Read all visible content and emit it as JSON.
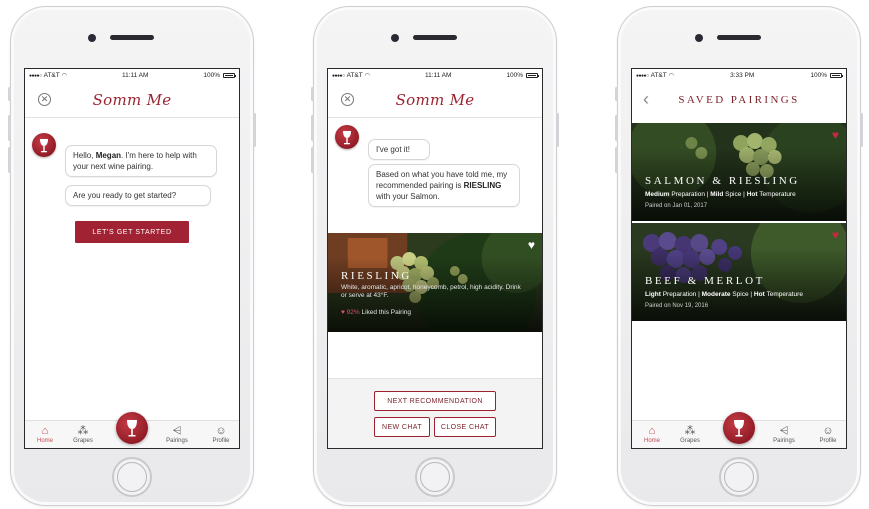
{
  "status_bar": {
    "screen1": {
      "carrier": "AT&T",
      "time": "11:11 AM",
      "battery": "100%"
    },
    "screen2": {
      "carrier": "AT&T",
      "time": "11:11 AM",
      "battery": "100%"
    },
    "screen3": {
      "carrier": "AT&T",
      "time": "3:33 PM",
      "battery": "100%"
    }
  },
  "app": {
    "logo_text": "Somm Me"
  },
  "screen1": {
    "greeting_hello": "Hello, ",
    "greeting_name": "Megan",
    "greeting_rest": ". I'm here to help with your next wine pairing.",
    "question": "Are you ready to get started?",
    "start_button": "LET'S GET STARTED"
  },
  "screen2": {
    "bubble_got_it": "I've got it!",
    "recommend_before": "Based on what you have told me, my recommended pairing is ",
    "recommend_wine": "RIESLING",
    "recommend_after": " with your Salmon.",
    "card": {
      "name": "RIESLING",
      "description": "White, aromatic, apricot, honeycomb, petrol, high acidity. Drink or serve at 43°F.",
      "like_percent": "92%",
      "like_text": " Liked this Pairing"
    },
    "next_button": "NEXT RECOMMENDATION",
    "new_chat_button": "NEW CHAT",
    "close_chat_button": "CLOSE CHAT"
  },
  "screen3": {
    "title": "SAVED PAIRINGS",
    "pairings": [
      {
        "name": "SALMON & RIESLING",
        "prep_value": "Medium",
        "prep_label": " Preparation",
        "spice_value": "Mild",
        "spice_label": " Spice",
        "temp_value": "Hot",
        "temp_label": " Temperature",
        "date": "Paired on Jan 01, 2017"
      },
      {
        "name": "BEEF & MERLOT",
        "prep_value": "Light",
        "prep_label": " Preparation",
        "spice_value": "Moderate",
        "spice_label": " Spice",
        "temp_value": "Hot",
        "temp_label": " Temperature",
        "date": "Paired on Nov 19, 2016"
      }
    ],
    "separator": " | "
  },
  "tab_bar": {
    "items": [
      {
        "label": "Home",
        "icon": "home-icon"
      },
      {
        "label": "Grapes",
        "icon": "grapes-icon"
      },
      {
        "label": "",
        "icon": "somm-wine-glass-icon"
      },
      {
        "label": "Pairings",
        "icon": "pairings-icon"
      },
      {
        "label": "Profile",
        "icon": "profile-icon"
      }
    ]
  },
  "colors": {
    "brand": "#9b2330",
    "button_fill": "#a12232",
    "heart_active": "#c8283c",
    "tab_active": "#c44a54"
  }
}
